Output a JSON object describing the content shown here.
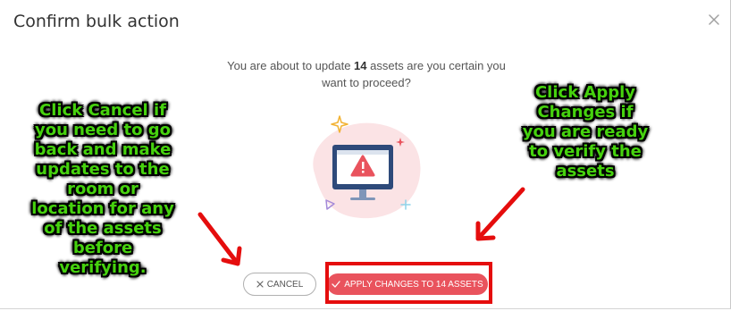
{
  "dialog": {
    "title": "Confirm bulk action",
    "close_icon": "close-icon",
    "message_before": "You are about to update ",
    "asset_count": "14",
    "message_after": " assets are you certain you want to proceed?"
  },
  "buttons": {
    "cancel_label": "CANCEL",
    "cancel_icon": "close-icon",
    "apply_label": "APPLY CHANGES TO 14 ASSETS",
    "apply_icon": "check-icon"
  },
  "annotations": {
    "left_note": "Click Cancel if\nyou need to go\nback and make\nupdates to the\nroom or\nlocation for any\nof the assets\nbefore\nverifying.",
    "right_note": "Click Apply\nChanges if\nyou are ready\nto verify the\nassets"
  },
  "colors": {
    "accent": "#e9535d",
    "annotation_text": "#46d20e",
    "annotation_arrow": "#e50d0d"
  }
}
